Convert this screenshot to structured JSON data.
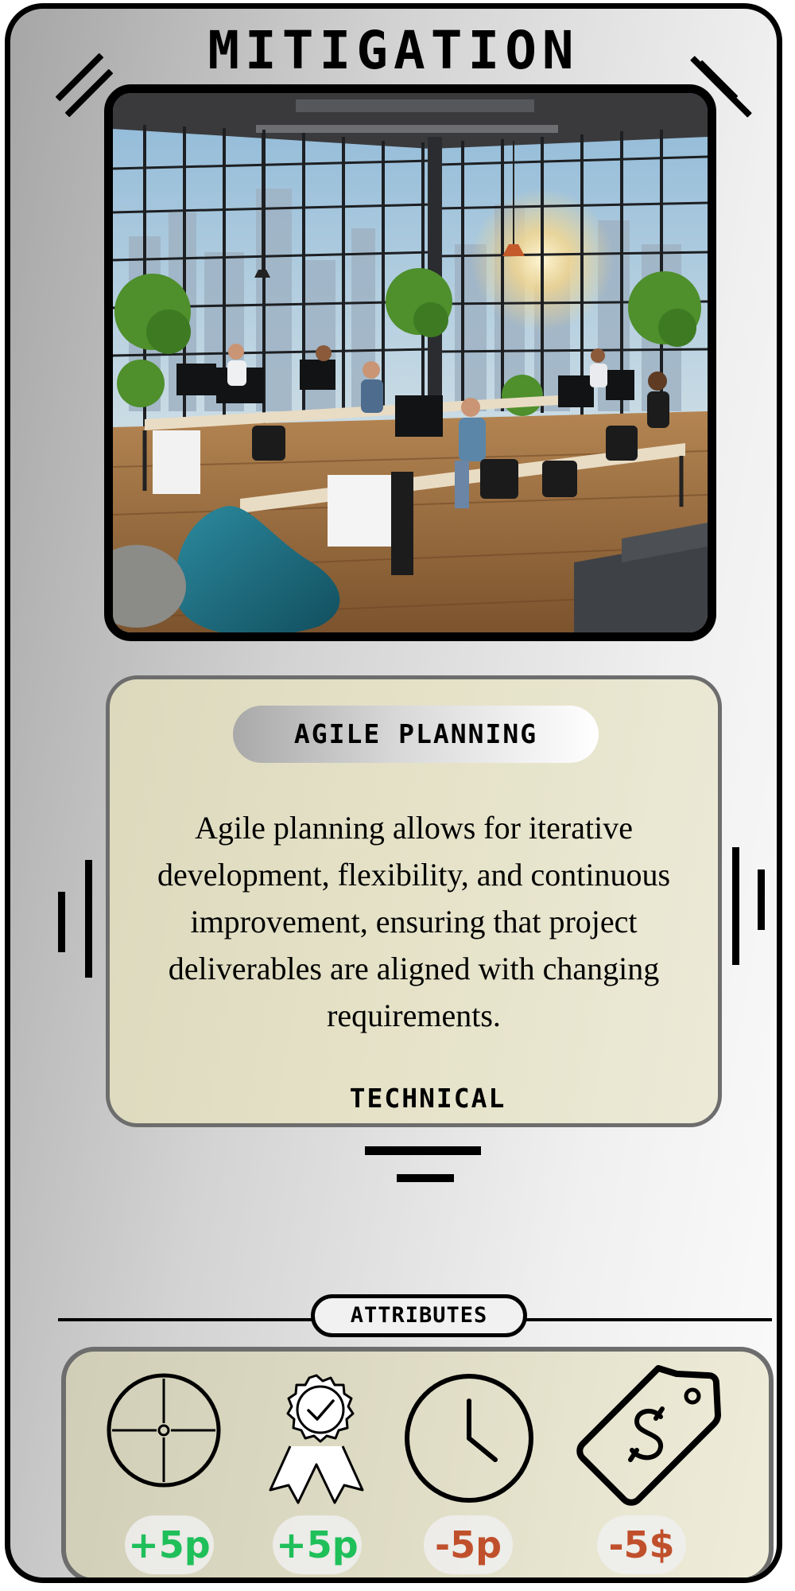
{
  "card": {
    "type_label": "MITIGATION",
    "name": "AGILE PLANNING",
    "description": "Agile planning allows for iterative development, flexibility, and continuous improvement, ensuring that project deliverables are aligned with changing requirements.",
    "category": "TECHNICAL"
  },
  "attributes": {
    "header": "ATTRIBUTES",
    "items": [
      {
        "icon": "crosshair-icon",
        "value": "+5p",
        "color": "#1fbf5a"
      },
      {
        "icon": "award-ribbon-icon",
        "value": "+5p",
        "color": "#1fbf5a"
      },
      {
        "icon": "clock-icon",
        "value": "-5p",
        "color": "#c0502c"
      },
      {
        "icon": "price-tag-dollar-icon",
        "value": "-5$",
        "color": "#c0502c"
      }
    ]
  },
  "colors": {
    "positive": "#1fbf5a",
    "negative": "#c0502c",
    "panel": "#e3e0c6"
  }
}
